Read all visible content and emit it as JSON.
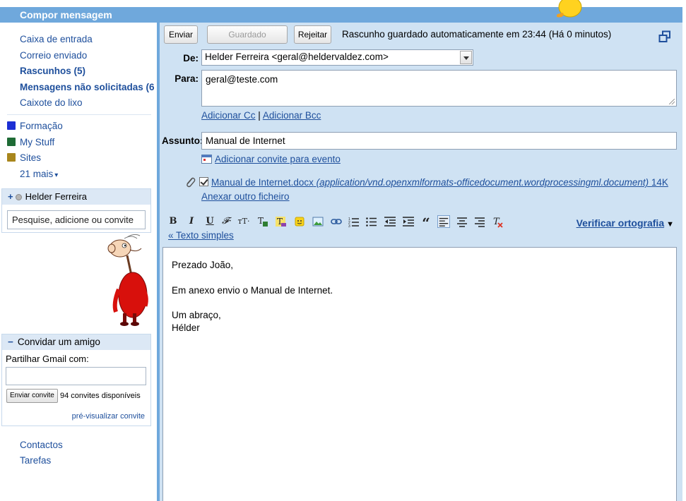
{
  "header": {
    "title": "Compor mensagem"
  },
  "nav": {
    "items": [
      {
        "label": "Caixa de entrada",
        "bold": false
      },
      {
        "label": "Correio enviado",
        "bold": false
      },
      {
        "label": "Rascunhos (5)",
        "bold": true
      },
      {
        "label": "Mensagens não solicitadas (6",
        "bold": true
      },
      {
        "label": "Caixote do lixo",
        "bold": false
      }
    ]
  },
  "labels": {
    "items": [
      {
        "label": "Formação",
        "color": "#1c2fd4"
      },
      {
        "label": "My Stuff",
        "color": "#1e6b35"
      },
      {
        "label": "Sites",
        "color": "#a8861c"
      }
    ],
    "more": "21 mais"
  },
  "chat": {
    "name": "Helder Ferreira",
    "search_text": "Pesquise, adicione ou convite"
  },
  "invite": {
    "title": "Convidar um amigo",
    "share_label": "Partilhar Gmail com:",
    "button": "Enviar convite",
    "count_text": "94 convites disponíveis",
    "preview_link": "pré-visualizar convite"
  },
  "footer_links": [
    "Contactos",
    "Tarefas"
  ],
  "compose": {
    "buttons": {
      "send": "Enviar",
      "save": "Guardado",
      "discard": "Rejeitar"
    },
    "autosave_text": "Rascunho guardado automaticamente em 23:44 (Há 0 minutos)",
    "from_label": "De:",
    "from_value": "Helder Ferreira <geral@heldervaldez.com>",
    "to_label": "Para:",
    "to_value": "geral@teste.com",
    "add_cc": "Adicionar Cc",
    "cc_sep": "|",
    "add_bcc": "Adicionar Bcc",
    "subject_label": "Assunto:",
    "subject_value": "Manual de Internet",
    "add_event": "Adicionar convite para evento",
    "attachment": {
      "name": "Manual de Internet.docx",
      "type": "(application/vnd.openxmlformats-officedocument.wordprocessingml.document)",
      "size": "14K",
      "checked": true
    },
    "attach_other": "Anexar outro ficheiro",
    "spellcheck": "Verificar ortografia",
    "plain_text": "« Texto simples",
    "body": {
      "greeting": "Prezado João,",
      "line1": "Em anexo envio o Manual de Internet.",
      "closing": "Um abraço,",
      "signature": "Hélder"
    }
  },
  "colors": {
    "header_bg": "#6fa8dc",
    "compose_bg": "#cfe2f3",
    "link": "#1e4f9c"
  }
}
